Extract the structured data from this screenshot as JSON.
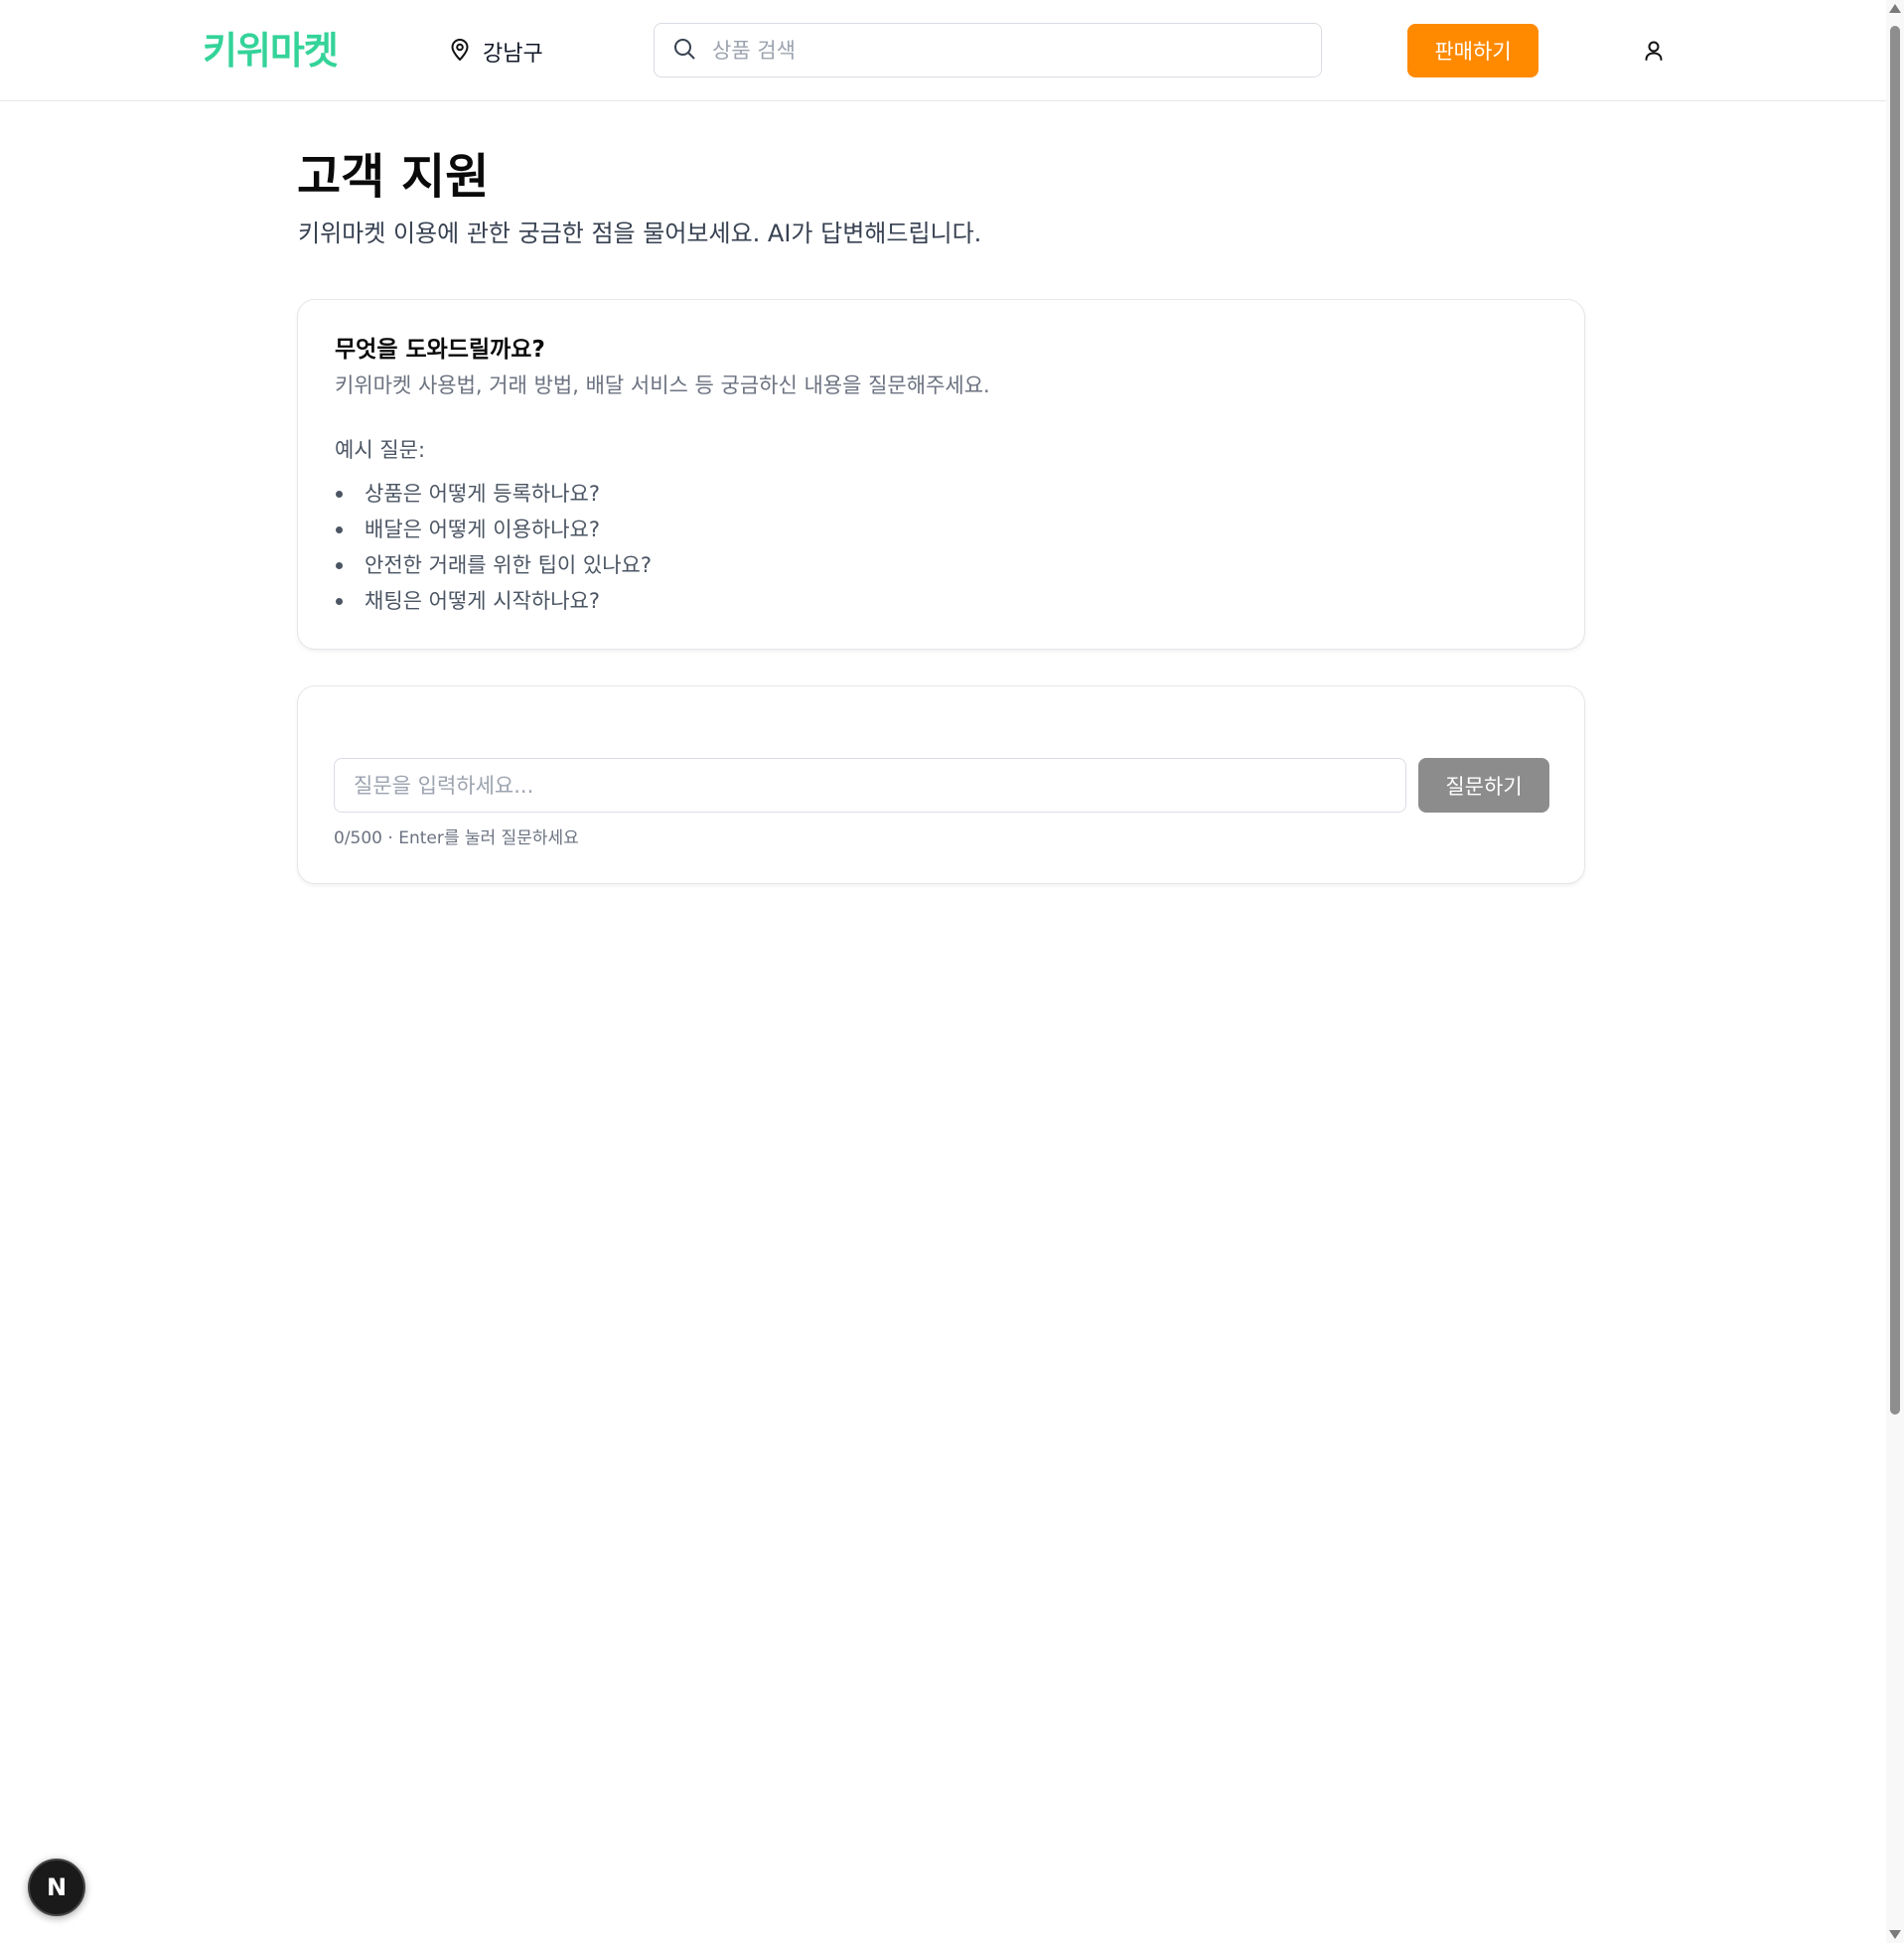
{
  "header": {
    "logo": "키위마켓",
    "location": {
      "icon": "map-pin-icon",
      "label": "강남구"
    },
    "search": {
      "icon": "search-icon",
      "placeholder": "상품 검색",
      "value": ""
    },
    "sell_button": "판매하기",
    "user_icon": "user-icon"
  },
  "main": {
    "title": "고객 지원",
    "subtitle": "키위마켓 이용에 관한 궁금한 점을 물어보세요. AI가 답변해드립니다.",
    "help_card": {
      "title": "무엇을 도와드릴까요?",
      "description": "키위마켓 사용법, 거래 방법, 배달 서비스 등 궁금하신 내용을 질문해주세요.",
      "examples_label": "예시 질문:",
      "examples": [
        "상품은 어떻게 등록하나요?",
        "배달은 어떻게 이용하나요?",
        "안전한 거래를 위한 팁이 있나요?",
        "채팅은 어떻게 시작하나요?"
      ]
    },
    "question_card": {
      "input_placeholder": "질문을 입력하세요...",
      "input_value": "",
      "ask_button": "질문하기",
      "hint": "0/500 · Enter를 눌러 질문하세요"
    }
  },
  "floating_badge": {
    "letter": "N"
  },
  "colors": {
    "brand": "#34d399",
    "accent": "#ff8a00",
    "disabled_button": "#8c8c8c",
    "text_primary": "#0a0a0a",
    "text_muted": "#6b7280"
  }
}
